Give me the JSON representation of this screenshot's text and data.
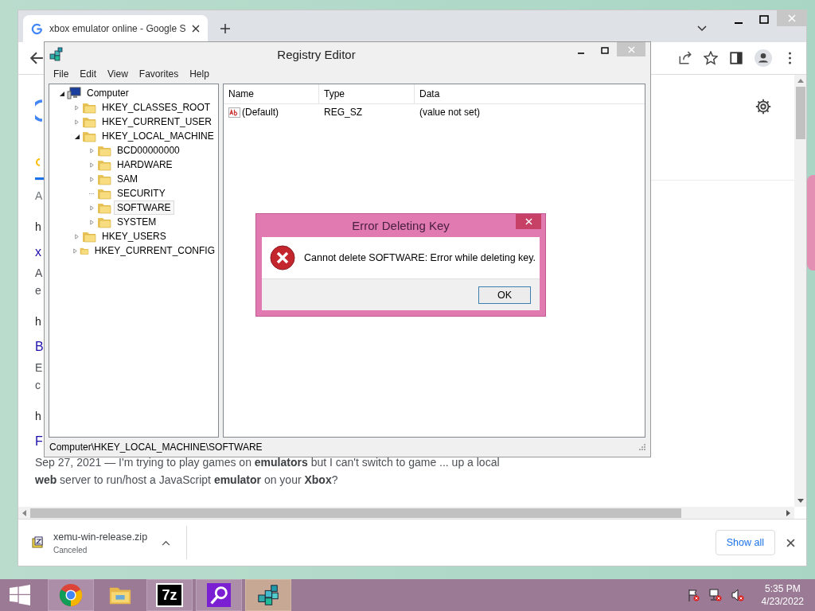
{
  "browser": {
    "tab": {
      "title": "xbox emulator online - Google S",
      "selected": true
    },
    "stats": "A",
    "results": [
      {
        "url": "h",
        "title": "x",
        "snippet": [
          "A",
          "e"
        ]
      },
      {
        "url": "h",
        "title": "B",
        "snippet": [
          "E",
          "c"
        ]
      },
      {
        "url": "h",
        "title": "F",
        "snippet": [
          "Sep 27, 2021 — I'm trying to play games on **emulators** but I can't switch to game ... up a local",
          "**web** server to run/host a JavaScript **emulator** on your **Xbox**?"
        ]
      }
    ],
    "download": {
      "file": "xemu-win-release.zip",
      "status": "Canceled",
      "show_all": "Show all"
    }
  },
  "regedit": {
    "title": "Registry Editor",
    "menu": [
      "File",
      "Edit",
      "View",
      "Favorites",
      "Help"
    ],
    "tree": [
      {
        "label": "Computer",
        "kind": "computer",
        "expandable": true,
        "expanded": true,
        "selected": false,
        "children": [
          {
            "label": "HKEY_CLASSES_ROOT",
            "kind": "folder",
            "expandable": true,
            "expanded": false,
            "selected": false
          },
          {
            "label": "HKEY_CURRENT_USER",
            "kind": "folder",
            "expandable": true,
            "expanded": false,
            "selected": false
          },
          {
            "label": "HKEY_LOCAL_MACHINE",
            "kind": "folder",
            "expandable": true,
            "expanded": true,
            "selected": false,
            "children": [
              {
                "label": "BCD00000000",
                "kind": "folder",
                "expandable": true,
                "expanded": false,
                "selected": false
              },
              {
                "label": "HARDWARE",
                "kind": "folder",
                "expandable": true,
                "expanded": false,
                "selected": false
              },
              {
                "label": "SAM",
                "kind": "folder",
                "expandable": true,
                "expanded": false,
                "selected": false
              },
              {
                "label": "SECURITY",
                "kind": "folder",
                "expandable": false,
                "expanded": false,
                "selected": false
              },
              {
                "label": "SOFTWARE",
                "kind": "folder",
                "expandable": true,
                "expanded": false,
                "selected": true
              },
              {
                "label": "SYSTEM",
                "kind": "folder",
                "expandable": true,
                "expanded": false,
                "selected": false
              }
            ]
          },
          {
            "label": "HKEY_USERS",
            "kind": "folder",
            "expandable": true,
            "expanded": false,
            "selected": false
          },
          {
            "label": "HKEY_CURRENT_CONFIG",
            "kind": "folder",
            "expandable": true,
            "expanded": false,
            "selected": false
          }
        ]
      }
    ],
    "columns": [
      "Name",
      "Type",
      "Data"
    ],
    "rows": [
      {
        "name": "(Default)",
        "type": "REG_SZ",
        "data": "(value not set)"
      }
    ],
    "status": "Computer\\HKEY_LOCAL_MACHINE\\SOFTWARE"
  },
  "dialog": {
    "title": "Error Deleting Key",
    "message": "Cannot delete SOFTWARE:  Error while deleting key.",
    "button": "OK"
  },
  "taskbar": {
    "apps": [
      {
        "kind": "chrome",
        "running": true,
        "active": false
      },
      {
        "kind": "explorer",
        "running": false,
        "active": false
      },
      {
        "kind": "sevenzip",
        "label": "7z",
        "running": true,
        "active": false
      },
      {
        "kind": "search",
        "running": true,
        "active": false
      },
      {
        "kind": "regedit",
        "running": true,
        "active": true
      }
    ],
    "time": "5:35 PM",
    "date": "4/23/2022"
  }
}
